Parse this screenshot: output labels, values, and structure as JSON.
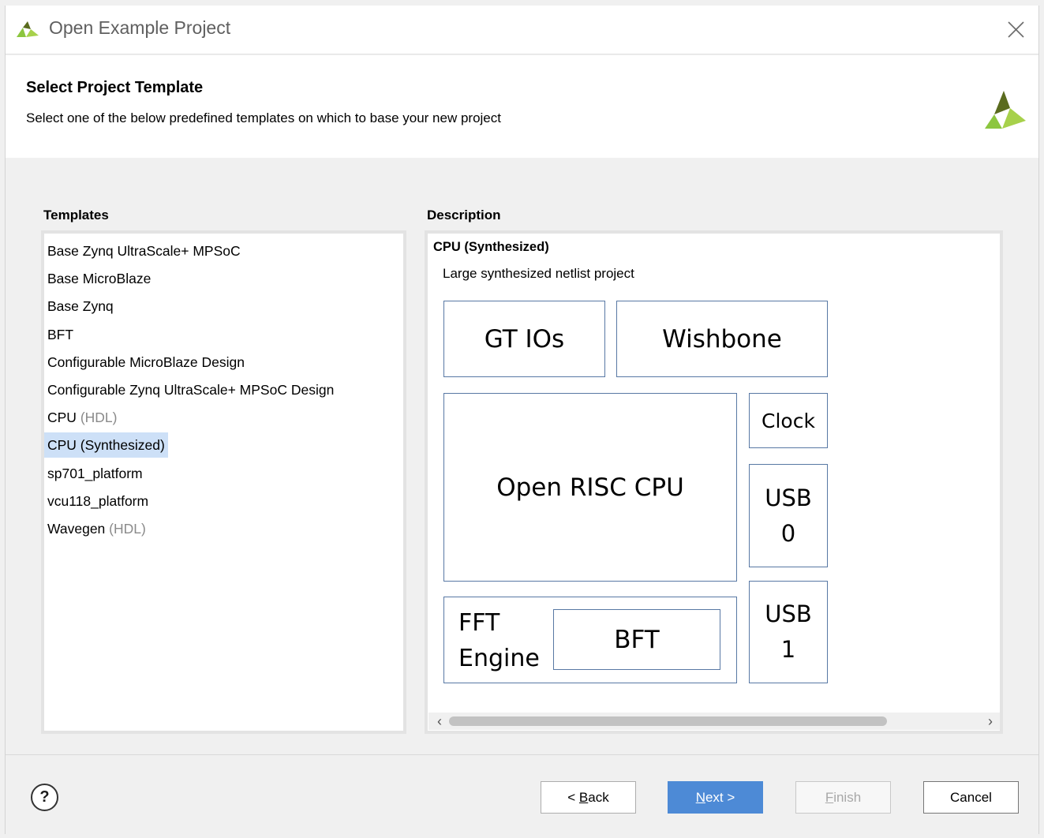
{
  "window": {
    "title": "Open Example Project",
    "close_icon": "close-icon"
  },
  "header": {
    "title": "Select Project Template",
    "subtitle": "Select one of the below predefined templates on which to base your new project"
  },
  "templates": {
    "label": "Templates",
    "items": [
      {
        "name": "Base Zynq UltraScale+ MPSoC",
        "suffix": ""
      },
      {
        "name": "Base MicroBlaze",
        "suffix": ""
      },
      {
        "name": "Base Zynq",
        "suffix": ""
      },
      {
        "name": "BFT",
        "suffix": ""
      },
      {
        "name": "Configurable MicroBlaze Design",
        "suffix": ""
      },
      {
        "name": "Configurable Zynq UltraScale+ MPSoC Design",
        "suffix": ""
      },
      {
        "name": "CPU",
        "suffix": "(HDL)"
      },
      {
        "name": "CPU (Synthesized)",
        "suffix": "",
        "selected": true
      },
      {
        "name": "sp701_platform",
        "suffix": ""
      },
      {
        "name": "vcu118_platform",
        "suffix": ""
      },
      {
        "name": "Wavegen",
        "suffix": "(HDL)"
      }
    ]
  },
  "description": {
    "label": "Description",
    "title": "CPU (Synthesized)",
    "text": "Large synthesized netlist project",
    "diagram": {
      "gt_ios": "GT IOs",
      "wishbone": "Wishbone",
      "open_risc": "Open RISC CPU",
      "clock": "Clock",
      "usb0": "USB\n0",
      "usb1": "USB\n1",
      "fft_engine": "FFT\nEngine",
      "bft": "BFT"
    }
  },
  "footer": {
    "help": "?",
    "back": {
      "prefix": "< ",
      "key": "B",
      "rest": "ack"
    },
    "next": {
      "key": "N",
      "rest": "ext >"
    },
    "finish": {
      "key": "F",
      "rest": "inish"
    },
    "cancel": "Cancel"
  },
  "colors": {
    "accent": "#4d8ad6",
    "selection": "#cde0f7",
    "diagram_border": "#5878a4",
    "logo_green": "#8cc63f",
    "logo_olive": "#5a6b1e"
  }
}
